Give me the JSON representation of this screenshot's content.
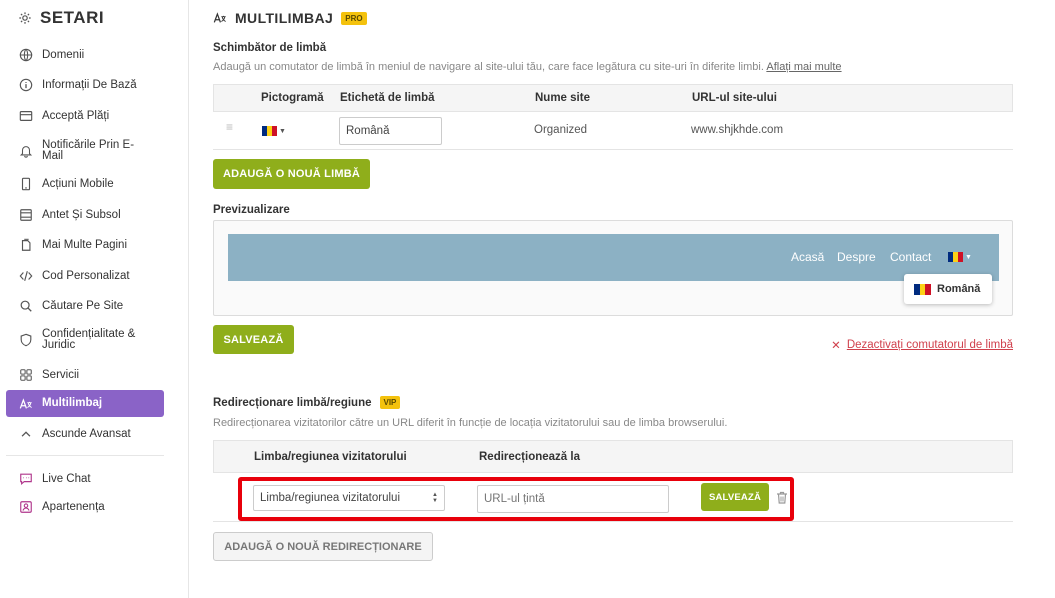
{
  "sidebar": {
    "title": "SETARI",
    "items": [
      {
        "label": "Domenii",
        "icon": "globe-icon"
      },
      {
        "label": "Informații De Bază",
        "icon": "info-icon"
      },
      {
        "label": "Acceptă Plăți",
        "icon": "payment-card-icon"
      },
      {
        "label": "Notificările Prin E-Mail",
        "icon": "bell-icon"
      },
      {
        "label": "Acțiuni Mobile",
        "icon": "mobile-icon"
      },
      {
        "label": "Antet Și Subsol",
        "icon": "header-footer-icon"
      },
      {
        "label": "Mai Multe Pagini",
        "icon": "pages-icon"
      },
      {
        "label": "Cod Personalizat",
        "icon": "code-icon"
      },
      {
        "label": "Căutare Pe Site",
        "icon": "search-icon"
      },
      {
        "label": "Confidențialitate & Juridic",
        "icon": "shield-icon"
      },
      {
        "label": "Servicii",
        "icon": "grid-icon"
      },
      {
        "label": "Multilimbaj",
        "icon": "translate-icon"
      },
      {
        "label": "Ascunde Avansat",
        "icon": "chevron-up-icon"
      },
      {
        "label": "Live Chat",
        "icon": "chat-icon"
      },
      {
        "label": "Apartenența",
        "icon": "membership-icon"
      }
    ]
  },
  "page": {
    "title": "MULTILIMBAJ",
    "badge": "PRO"
  },
  "switcher": {
    "title": "Schimbător de limbă",
    "description": "Adaugă un comutator de limbă în meniul de navigare al site-ului tău, care face legătura cu site-uri în diferite limbi.",
    "learn_more": "Aflați mai multe",
    "columns": [
      "Pictogramă",
      "Etichetă de limbă",
      "Nume site",
      "URL-ul site-ului"
    ],
    "rows": [
      {
        "label_value": "Română",
        "site_name": "Organized",
        "site_url": "www.shjkhde.com"
      }
    ],
    "add_button": "ADAUGĂ O NOUĂ LIMBĂ"
  },
  "preview": {
    "title": "Previzualizare",
    "nav": [
      "Acasă",
      "Despre",
      "Contact"
    ],
    "dropdown_item": "Română",
    "save_button": "SALVEAZĂ",
    "deactivate_link": "Dezactivați comutatorul de limbă"
  },
  "redirect": {
    "title": "Redirecționare limbă/regiune",
    "badge": "VIP",
    "description": "Redirecționarea vizitatorilor către un URL diferit în funcție de locația vizitatorului sau de limba browserului.",
    "columns": [
      "Limba/regiunea vizitatorului",
      "Redirecționează la"
    ],
    "select_value": "Limba/regiunea vizitatorului",
    "url_placeholder": "URL-ul țintă",
    "save_button": "SALVEAZĂ",
    "add_button": "ADAUGĂ O NOUĂ REDIRECȚIONARE"
  },
  "colors": {
    "accent_purple": "#8a63c7",
    "button_green": "#8fae1b",
    "badge_yellow": "#f4c20d",
    "highlight_red": "#e8000b",
    "danger_red": "#d0404c",
    "preview_bar": "#8cb1c4"
  }
}
